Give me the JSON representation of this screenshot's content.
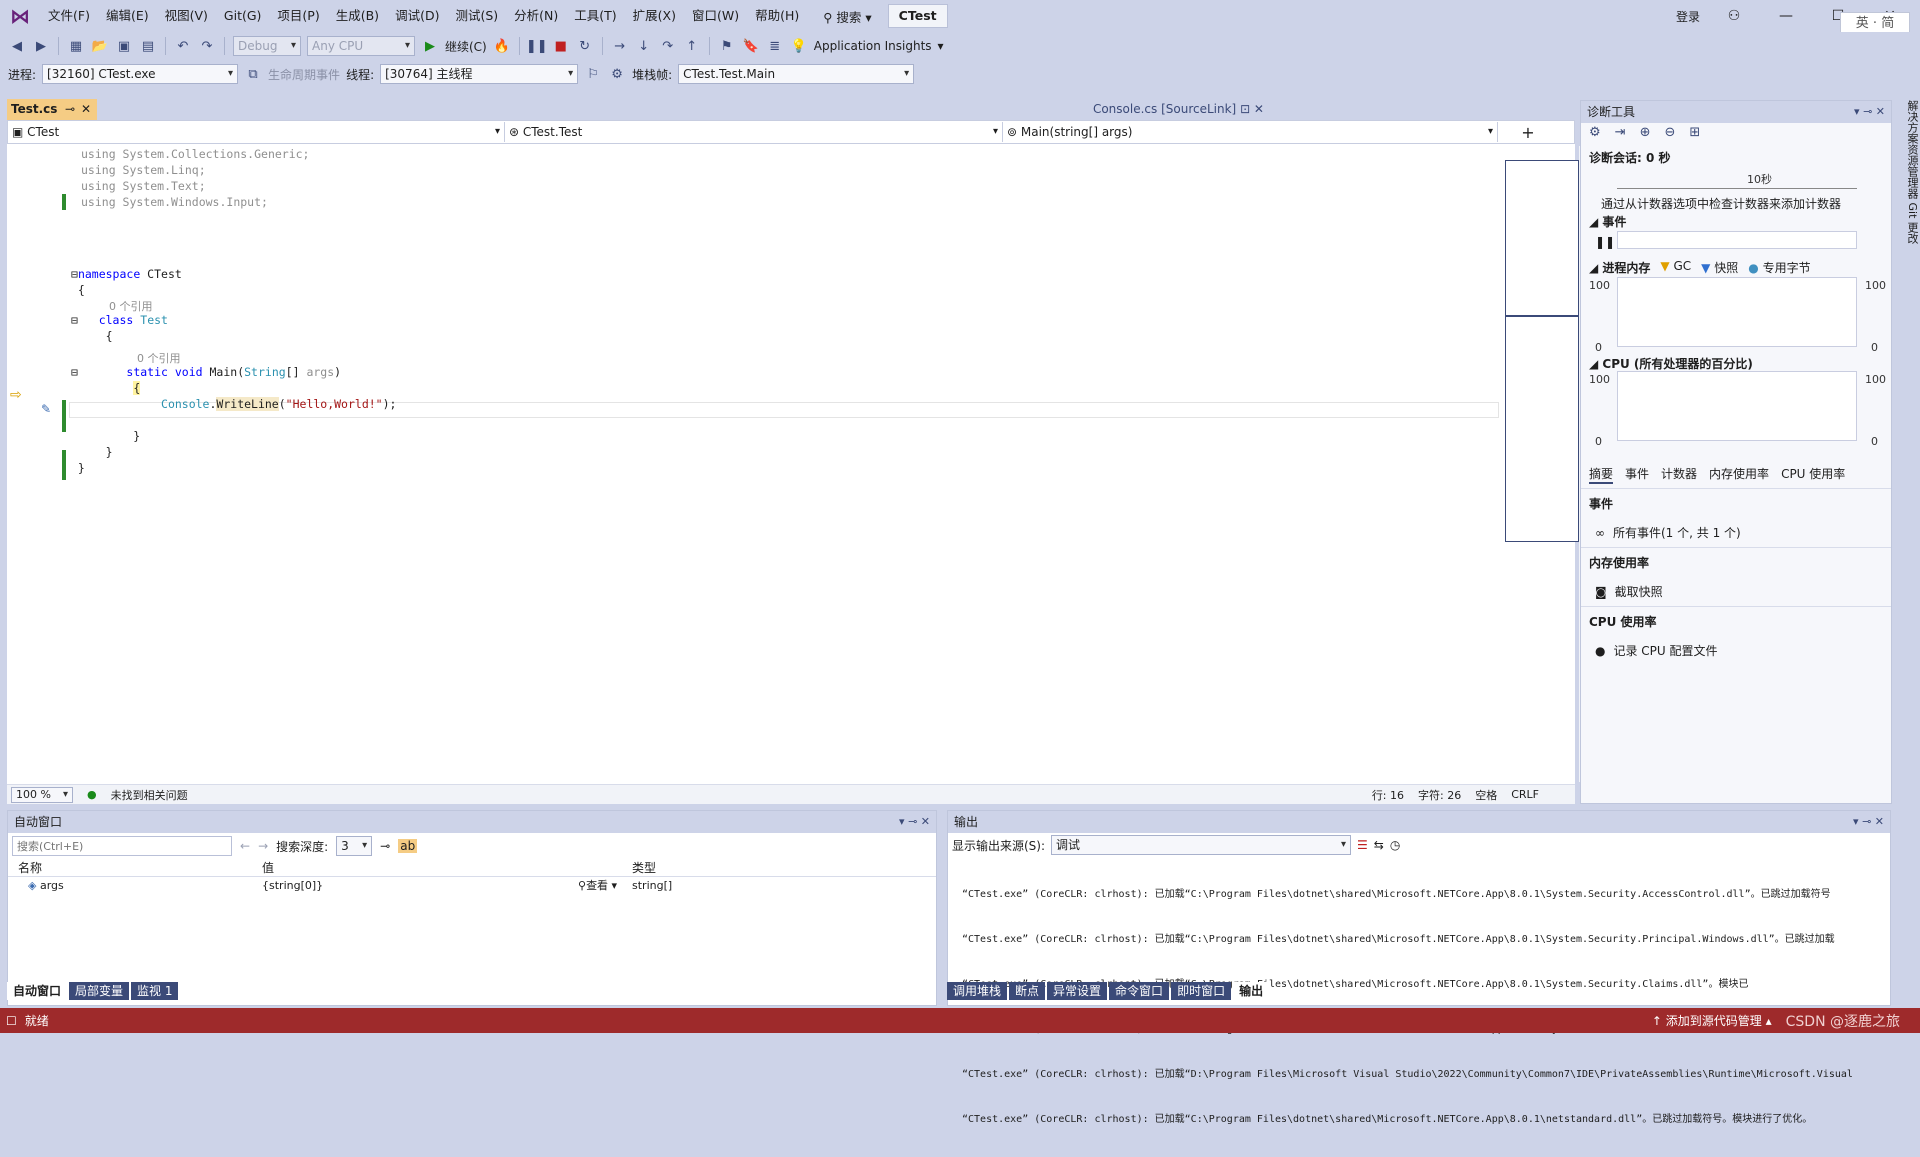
{
  "menu": {
    "items": [
      "文件(F)",
      "编辑(E)",
      "视图(V)",
      "Git(G)",
      "项目(P)",
      "生成(B)",
      "调试(D)",
      "测试(S)",
      "分析(N)",
      "工具(T)",
      "扩展(X)",
      "窗口(W)",
      "帮助(H)"
    ],
    "search": "搜索",
    "solution": "CTest",
    "login": "登录",
    "ime": "英 · 简"
  },
  "toolbar1": {
    "config": "Debug",
    "platform": "Any CPU",
    "continue": "继续(C)",
    "app_insights": "Application Insights"
  },
  "toolbar2": {
    "process_label": "进程:",
    "process": "[32160] CTest.exe",
    "lifecycle": "生命周期事件",
    "thread_label": "线程:",
    "thread": "[30764] 主线程",
    "stack_label": "堆栈帧:",
    "stack": "CTest.Test.Main"
  },
  "editor": {
    "tab": "Test.cs",
    "tab_right": "Console.cs [SourceLink]",
    "nav": [
      "CTest",
      "CTest.Test",
      "Main(string[] args)"
    ],
    "refs": "0 个引用",
    "zoom": "100 %",
    "issues": "未找到相关问题",
    "line": "行: 16",
    "col": "字符: 26",
    "space": "空格",
    "eol": "CRLF"
  },
  "diag": {
    "title": "诊断工具",
    "session": "诊断会话: 0 秒",
    "tick": "10秒",
    "hint": "通过从计数器选项中检查计数器来添加计数器",
    "events": "事件",
    "memory": "进程内存",
    "gc": "GC",
    "snapshot": "快照",
    "private": "专用字节",
    "cpu": "CPU (所有处理器的百分比)",
    "v100": "100",
    "v0": "0",
    "tabs": [
      "摘要",
      "事件",
      "计数器",
      "内存使用率",
      "CPU 使用率"
    ],
    "sec_events": "事件",
    "all_events": "所有事件(1 个, 共 1 个)",
    "sec_mem": "内存使用率",
    "take_snapshot": "截取快照",
    "sec_cpu": "CPU 使用率",
    "record_cpu": "记录 CPU 配置文件"
  },
  "vstrip": "解决方案资源管理器   Git 更改",
  "autos": {
    "title": "自动窗口",
    "search_placeholder": "搜索(Ctrl+E)",
    "depth_label": "搜索深度:",
    "depth": "3",
    "cols": [
      "名称",
      "值",
      "类型"
    ],
    "row": {
      "name": "args",
      "value": "{string[0]}",
      "view": "查看",
      "type": "string[]"
    },
    "tabs": [
      "自动窗口",
      "局部变量",
      "监视 1"
    ]
  },
  "output": {
    "title": "输出",
    "source_label": "显示输出来源(S):",
    "source": "调试",
    "lines": [
      "“CTest.exe” (CoreCLR: clrhost): 已加载“C:\\Program Files\\dotnet\\shared\\Microsoft.NETCore.App\\8.0.1\\System.Security.AccessControl.dll”。已跳过加载符号",
      "“CTest.exe” (CoreCLR: clrhost): 已加载“C:\\Program Files\\dotnet\\shared\\Microsoft.NETCore.App\\8.0.1\\System.Security.Principal.Windows.dll”。已跳过加载",
      "“CTest.exe” (CoreCLR: clrhost): 已加载“C:\\Program Files\\dotnet\\shared\\Microsoft.NETCore.App\\8.0.1\\System.Security.Claims.dll”。模块已",
      "“CTest.exe” (CoreCLR: clrhost): 已加载“C:\\Program Files\\dotnet\\shared\\Microsoft.NETCore.App\\8.0.1\\System.Runtime.Loader.dll”。已跳过加载符号。模块",
      "“CTest.exe” (CoreCLR: clrhost): 已加载“D:\\Program Files\\Microsoft Visual Studio\\2022\\Community\\Common7\\IDE\\PrivateAssemblies\\Runtime\\Microsoft.Visual",
      "“CTest.exe” (CoreCLR: clrhost): 已加载“C:\\Program Files\\dotnet\\shared\\Microsoft.NETCore.App\\8.0.1\\netstandard.dll”。已跳过加载符号。模块进行了优化。"
    ],
    "tabs": [
      "调用堆栈",
      "断点",
      "异常设置",
      "命令窗口",
      "即时窗口",
      "输出"
    ]
  },
  "status": {
    "ready": "就绪",
    "source_control": "添加到源代码管理",
    "watermark": "CSDN @逐鹿之旅"
  }
}
